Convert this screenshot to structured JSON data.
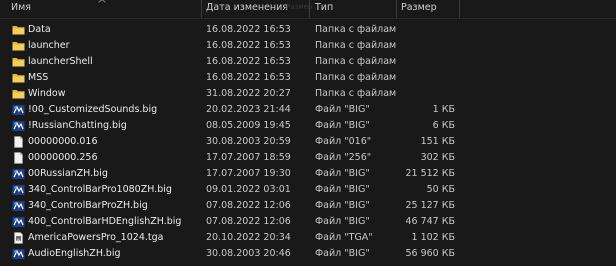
{
  "columns": {
    "name": "Имя",
    "date": "Дата изменения",
    "type": "Тип",
    "size": "Размер"
  },
  "ghost_text": "Размер",
  "rows": [
    {
      "icon": "folder-icon",
      "name": "Data",
      "date": "16.08.2022 16:53",
      "type": "Папка с файлами",
      "size": ""
    },
    {
      "icon": "folder-icon",
      "name": "launcher",
      "date": "16.08.2022 16:53",
      "type": "Папка с файлами",
      "size": ""
    },
    {
      "icon": "folder-icon",
      "name": "launcherShell",
      "date": "16.08.2022 16:53",
      "type": "Папка с файлами",
      "size": ""
    },
    {
      "icon": "folder-icon",
      "name": "MSS",
      "date": "16.08.2022 16:53",
      "type": "Папка с файлами",
      "size": ""
    },
    {
      "icon": "folder-icon",
      "name": "Window",
      "date": "31.08.2022 20:27",
      "type": "Папка с файлами",
      "size": ""
    },
    {
      "icon": "big-file-icon",
      "name": "!00_CustomizedSounds.big",
      "date": "20.02.2023 21:44",
      "type": "Файл \"BIG\"",
      "size": "1 КБ"
    },
    {
      "icon": "big-file-icon",
      "name": "!RussianChatting.big",
      "date": "08.05.2009 19:45",
      "type": "Файл \"BIG\"",
      "size": "6 КБ"
    },
    {
      "icon": "generic-file-icon",
      "name": "00000000.016",
      "date": "30.08.2003 20:59",
      "type": "Файл \"016\"",
      "size": "151 КБ"
    },
    {
      "icon": "generic-file-icon",
      "name": "00000000.256",
      "date": "17.07.2007 18:59",
      "type": "Файл \"256\"",
      "size": "302 КБ"
    },
    {
      "icon": "big-file-icon",
      "name": "00RussianZH.big",
      "date": "17.07.2007 19:30",
      "type": "Файл \"BIG\"",
      "size": "21 512 КБ"
    },
    {
      "icon": "big-file-icon",
      "name": "340_ControlBarPro1080ZH.big",
      "date": "09.01.2022 03:01",
      "type": "Файл \"BIG\"",
      "size": "50 КБ"
    },
    {
      "icon": "big-file-icon",
      "name": "340_ControlBarProZH.big",
      "date": "07.08.2022 12:06",
      "type": "Файл \"BIG\"",
      "size": "25 127 КБ"
    },
    {
      "icon": "big-file-icon",
      "name": "400_ControlBarHDEnglishZH.big",
      "date": "07.08.2022 12:06",
      "type": "Файл \"BIG\"",
      "size": "46 747 КБ"
    },
    {
      "icon": "tga-file-icon",
      "name": "AmericaPowersPro_1024.tga",
      "date": "20.10.2022 20:34",
      "type": "Файл \"TGA\"",
      "size": "1 102 КБ"
    },
    {
      "icon": "big-file-icon",
      "name": "AudioEnglishZH.big",
      "date": "30.08.2003 20:46",
      "type": "Файл \"BIG\"",
      "size": "56 960 КБ"
    }
  ]
}
